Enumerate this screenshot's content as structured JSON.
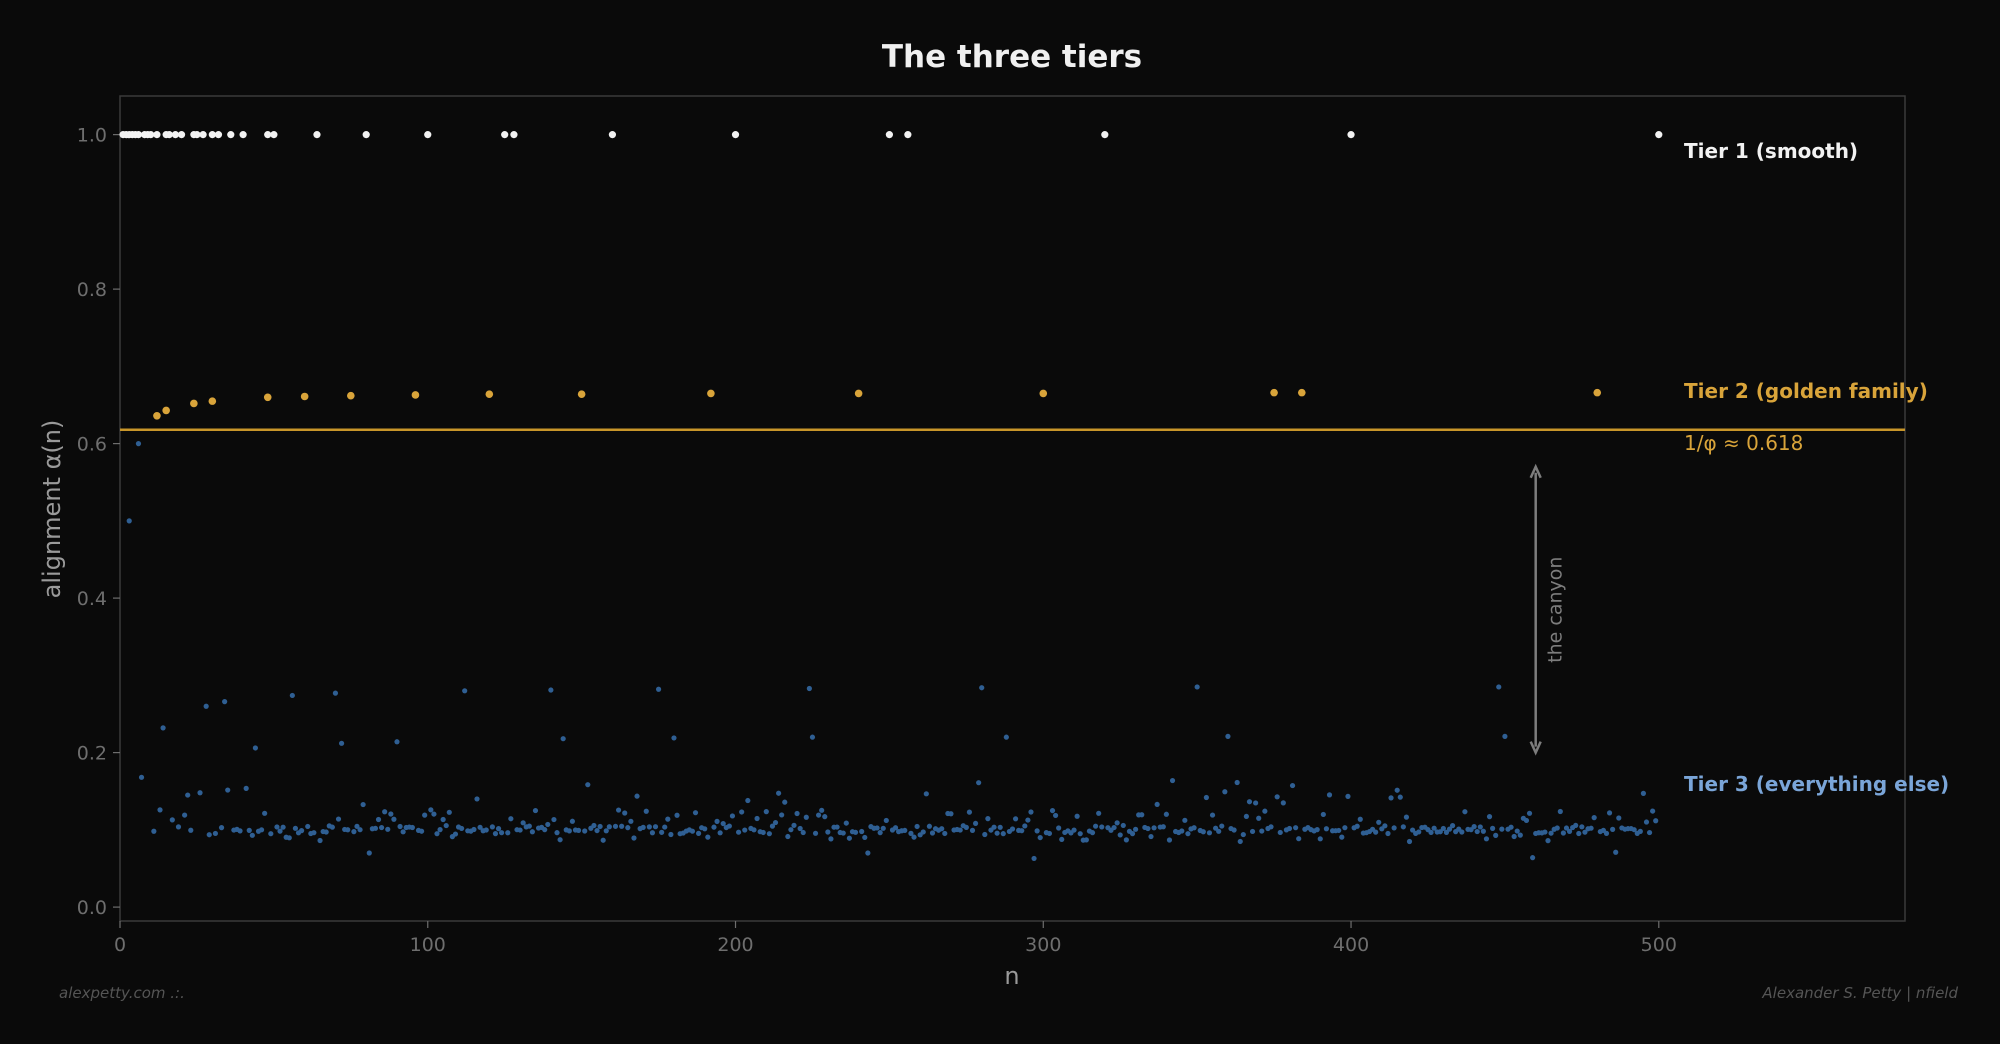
{
  "chart_data": {
    "type": "scatter",
    "title": "The three tiers",
    "xlabel": "n",
    "ylabel": "alignment α(n)",
    "xlim": [
      0,
      580
    ],
    "ylim": [
      -0.018,
      1.05
    ],
    "xticks": [
      0,
      100,
      200,
      300,
      400,
      500
    ],
    "yticks": [
      0.0,
      0.2,
      0.4,
      0.6,
      0.8,
      1.0
    ],
    "ytick_labels": [
      "0.0",
      "0.2",
      "0.4",
      "0.6",
      "0.8",
      "1.0"
    ],
    "grid": false,
    "colors": {
      "background": "#0a0a0a",
      "tier1": "#f2f2f2",
      "tier2": "#d9a43a",
      "tier3": "#2f5f93",
      "tier3_label": "#7aa5d8",
      "reference_line": "#c8962a",
      "canyon": "#7d7d7d",
      "spine": "#3a3a3a"
    },
    "series": [
      {
        "name": "Tier 1 (smooth)",
        "points": [
          [
            1,
            1.0
          ],
          [
            2,
            1.0
          ],
          [
            3,
            1.0
          ],
          [
            4,
            1.0
          ],
          [
            5,
            1.0
          ],
          [
            6,
            1.0
          ],
          [
            8,
            1.0
          ],
          [
            9,
            1.0
          ],
          [
            10,
            1.0
          ],
          [
            12,
            1.0
          ],
          [
            15,
            1.0
          ],
          [
            16,
            1.0
          ],
          [
            18,
            1.0
          ],
          [
            20,
            1.0
          ],
          [
            24,
            1.0
          ],
          [
            25,
            1.0
          ],
          [
            27,
            1.0
          ],
          [
            30,
            1.0
          ],
          [
            32,
            1.0
          ],
          [
            36,
            1.0
          ],
          [
            40,
            1.0
          ],
          [
            48,
            1.0
          ],
          [
            50,
            1.0
          ],
          [
            64,
            1.0
          ],
          [
            80,
            1.0
          ],
          [
            100,
            1.0
          ],
          [
            125,
            1.0
          ],
          [
            128,
            1.0
          ],
          [
            160,
            1.0
          ],
          [
            200,
            1.0
          ],
          [
            250,
            1.0
          ],
          [
            256,
            1.0
          ],
          [
            320,
            1.0
          ],
          [
            400,
            1.0
          ],
          [
            500,
            1.0
          ]
        ]
      },
      {
        "name": "Tier 2 (golden family)",
        "points": [
          [
            12,
            0.636
          ],
          [
            15,
            0.643
          ],
          [
            24,
            0.652
          ],
          [
            30,
            0.655
          ],
          [
            48,
            0.66
          ],
          [
            60,
            0.661
          ],
          [
            75,
            0.662
          ],
          [
            96,
            0.663
          ],
          [
            120,
            0.664
          ],
          [
            150,
            0.664
          ],
          [
            192,
            0.665
          ],
          [
            240,
            0.665
          ],
          [
            300,
            0.665
          ],
          [
            375,
            0.666
          ],
          [
            384,
            0.666
          ],
          [
            480,
            0.666
          ]
        ]
      },
      {
        "name": "Tier 3 (everything else)",
        "points": [
          [
            3,
            0.5
          ],
          [
            6,
            0.6
          ]
        ],
        "generated_range": [
          7,
          499
        ],
        "typical": 0.1,
        "outliers": [
          [
            7,
            0.168
          ],
          [
            9,
            0.127
          ],
          [
            14,
            0.232
          ],
          [
            18,
            0.178
          ],
          [
            22,
            0.145
          ],
          [
            26,
            0.148
          ],
          [
            27,
            0.065
          ],
          [
            28,
            0.26
          ],
          [
            34,
            0.266
          ],
          [
            36,
            0.201
          ],
          [
            44,
            0.206
          ],
          [
            56,
            0.274
          ],
          [
            70,
            0.277
          ],
          [
            72,
            0.212
          ],
          [
            90,
            0.214
          ],
          [
            112,
            0.28
          ],
          [
            140,
            0.281
          ],
          [
            144,
            0.218
          ],
          [
            175,
            0.282
          ],
          [
            180,
            0.219
          ],
          [
            224,
            0.283
          ],
          [
            225,
            0.22
          ],
          [
            280,
            0.284
          ],
          [
            288,
            0.22
          ],
          [
            350,
            0.285
          ],
          [
            360,
            0.221
          ],
          [
            448,
            0.285
          ],
          [
            450,
            0.221
          ],
          [
            81,
            0.07
          ],
          [
            243,
            0.07
          ],
          [
            297,
            0.063
          ],
          [
            459,
            0.064
          ],
          [
            486,
            0.071
          ]
        ]
      }
    ],
    "reference_line": {
      "y": 0.618,
      "label": "1/φ ≈ 0.618"
    },
    "annotation": {
      "text": "the canyon",
      "x": 460,
      "y_from": 0.57,
      "y_to": 0.2
    }
  },
  "footer": {
    "left": "alexpetty.com  .:.",
    "right": "Alexander S. Petty  |  nfield"
  }
}
